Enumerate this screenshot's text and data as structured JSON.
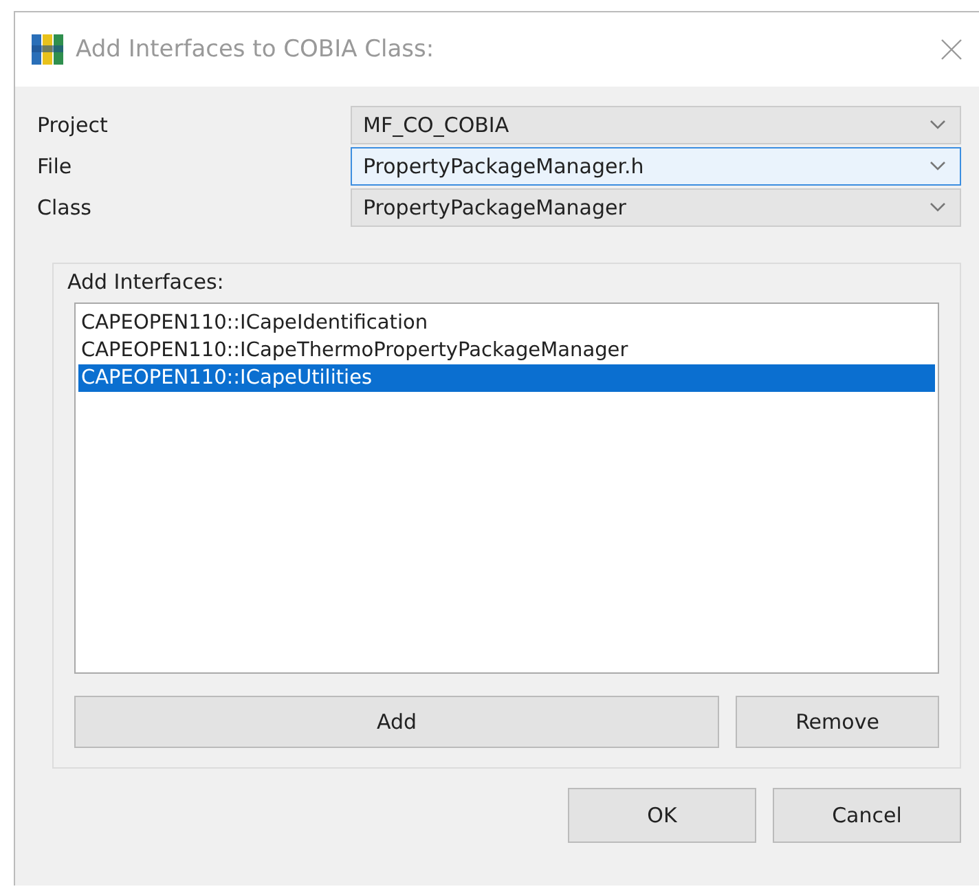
{
  "window": {
    "title": "Add Interfaces to COBIA Class:"
  },
  "fields": [
    {
      "label": "Project",
      "value": "MF_CO_COBIA",
      "focused": false
    },
    {
      "label": "File",
      "value": "PropertyPackageManager.h",
      "focused": true
    },
    {
      "label": "Class",
      "value": "PropertyPackageManager",
      "focused": false
    }
  ],
  "group": {
    "title": "Add Interfaces:",
    "items": [
      {
        "text": "CAPEOPEN110::ICapeIdentification",
        "selected": false
      },
      {
        "text": "CAPEOPEN110::ICapeThermoPropertyPackageManager",
        "selected": false
      },
      {
        "text": "CAPEOPEN110::ICapeUtilities",
        "selected": true
      }
    ],
    "buttons": [
      "Add",
      "Remove"
    ]
  },
  "buttons": [
    "OK",
    "Cancel"
  ]
}
